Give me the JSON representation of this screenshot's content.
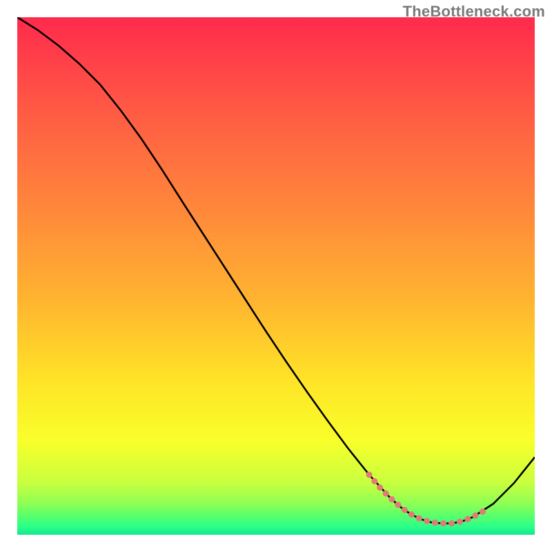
{
  "watermark": "TheBottleneck.com",
  "chart_data": {
    "type": "line",
    "title": "",
    "xlabel": "",
    "ylabel": "",
    "xlim": [
      0,
      100
    ],
    "ylim": [
      0,
      100
    ],
    "grid": false,
    "legend": null,
    "background_gradient_stops": [
      {
        "offset": 0.0,
        "color": "#ff2a4d"
      },
      {
        "offset": 0.18,
        "color": "#ff5a44"
      },
      {
        "offset": 0.38,
        "color": "#ff8a3a"
      },
      {
        "offset": 0.55,
        "color": "#ffb530"
      },
      {
        "offset": 0.7,
        "color": "#ffe327"
      },
      {
        "offset": 0.82,
        "color": "#f8ff2a"
      },
      {
        "offset": 0.9,
        "color": "#c8ff3f"
      },
      {
        "offset": 0.94,
        "color": "#8dff55"
      },
      {
        "offset": 0.965,
        "color": "#55ff6e"
      },
      {
        "offset": 0.985,
        "color": "#2aff8a"
      },
      {
        "offset": 1.0,
        "color": "#14e78e"
      }
    ],
    "series": [
      {
        "name": "curve",
        "stroke": "#000000",
        "stroke_width": 2.6,
        "fill": null,
        "x": [
          0,
          4,
          8,
          12,
          16,
          20,
          24,
          28,
          32,
          36,
          40,
          44,
          48,
          52,
          56,
          60,
          64,
          68,
          72,
          74,
          76,
          78,
          80,
          82,
          84,
          86,
          88,
          92,
          96,
          100
        ],
        "values": [
          100,
          97.5,
          94.5,
          91,
          87,
          82,
          76.5,
          70.5,
          64.2,
          58,
          51.8,
          45.6,
          39.4,
          33.4,
          27.6,
          22,
          16.6,
          11.6,
          7.2,
          5.4,
          4.0,
          3.0,
          2.4,
          2.2,
          2.2,
          2.6,
          3.4,
          6.0,
          10.0,
          15.0
        ]
      },
      {
        "name": "valley-highlight",
        "stroke": "#e47a78",
        "stroke_width": 9,
        "stroke_linecap": "round",
        "dash": "0.1 12",
        "fill": null,
        "x": [
          68,
          70,
          72,
          74,
          76,
          78,
          80,
          82,
          84,
          86,
          88,
          90
        ],
        "values": [
          11.6,
          9.2,
          7.2,
          5.4,
          4.0,
          3.0,
          2.4,
          2.2,
          2.2,
          2.6,
          3.4,
          4.5
        ]
      }
    ]
  }
}
